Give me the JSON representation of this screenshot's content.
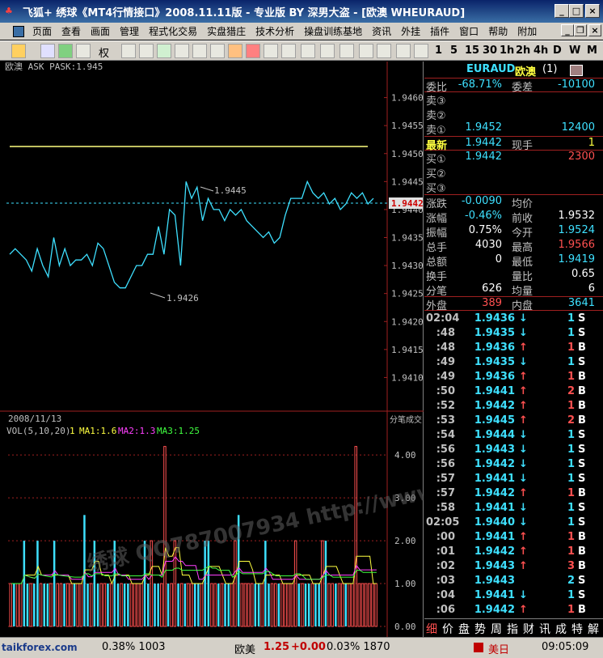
{
  "window": {
    "title": "飞狐+ 绣球《MT4行情接口》2008.11.11版 - 专业版 BY 深男大盗 - [欧澳 WHEURAUD]",
    "btn_minimize": "_",
    "btn_maximize": "□",
    "btn_close": "×",
    "child_minimize": "_",
    "child_restore": "❐",
    "child_close": "×"
  },
  "menu": [
    "页面",
    "查看",
    "画面",
    "管理",
    "程式化交易",
    "实盘猎庄",
    "技术分析",
    "操盘训练基地",
    "资讯",
    "外挂",
    "插件",
    "窗口",
    "帮助",
    "附加"
  ],
  "toolbar": {
    "quan_label": "权",
    "periods": [
      "1",
      "5",
      "15",
      "30",
      "1h",
      "2h",
      "4h",
      "D",
      "W",
      "M"
    ]
  },
  "chart": {
    "header": "欧澳 ASK PASK:1.945",
    "high_label": "1.9445",
    "low_label": "1.9426",
    "current_price_tag": "1.9442",
    "date_label": "2008/11/13",
    "minute_label": "分笔成交",
    "vol_indicator": {
      "name": "VOL(5,10,20)",
      "a": "1",
      "ma1": "MA1:1.6",
      "ma2": "MA2:1.3",
      "ma3": "MA3:1.25"
    },
    "price_ticks": [
      "1.9460",
      "1.9455",
      "1.9450",
      "1.9445",
      "1.9440",
      "1.9435",
      "1.9430",
      "1.9425",
      "1.9420",
      "1.9415",
      "1.9410"
    ],
    "vol_ticks": [
      "4.00",
      "3.00",
      "2.00",
      "1.00",
      "0.00"
    ],
    "watermark": "绣球 QQ787007934  http://www.iks.com",
    "colors": {
      "line": "#3ee0ff",
      "ma1": "#ffff40",
      "ma2": "#ff40ff",
      "ma3": "#40ff40",
      "upbar": "#ff5050",
      "downbar": "#3ee0ff"
    }
  },
  "chart_data": {
    "type": "line",
    "price": [
      1.9432,
      1.9433,
      1.9432,
      1.9431,
      1.9429,
      1.9433,
      1.943,
      1.9428,
      1.9435,
      1.943,
      1.9433,
      1.943,
      1.9431,
      1.9431,
      1.9432,
      1.943,
      1.9434,
      1.9433,
      1.943,
      1.9427,
      1.9426,
      1.9426,
      1.9428,
      1.943,
      1.943,
      1.9432,
      1.9432,
      1.9437,
      1.9432,
      1.944,
      1.9439,
      1.943,
      1.9445,
      1.9442,
      1.9444,
      1.9438,
      1.9442,
      1.944,
      1.944,
      1.9438,
      1.944,
      1.9439,
      1.944,
      1.9438,
      1.9437,
      1.9436,
      1.9435,
      1.9436,
      1.9434,
      1.9435,
      1.9439,
      1.9442,
      1.9442,
      1.9442,
      1.9445,
      1.9443,
      1.9442,
      1.9443,
      1.9441,
      1.9442,
      1.944,
      1.9441,
      1.9443,
      1.9442,
      1.9443,
      1.9441,
      1.9442
    ],
    "ylim": [
      1.9405,
      1.9465
    ],
    "volume_ylim": [
      0,
      4.4
    ]
  },
  "panel": {
    "symbol": "EURAUD",
    "name": "欧澳",
    "num": "(1)",
    "weibi_label": "委比",
    "weibi": "-68.71%",
    "weicha_label": "委差",
    "weicha": "-10100",
    "sell3": "卖③",
    "sell2": "卖②",
    "sell1": "卖①",
    "sell1_price": "1.9452",
    "sell1_vol": "12400",
    "last_label": "最新",
    "last": "1.9442",
    "xianshou_label": "现手",
    "xianshou": "1",
    "buy1": "买①",
    "buy1_price": "1.9442",
    "buy1_vol": "2300",
    "buy2": "买②",
    "buy3": "买③",
    "stats": [
      {
        "l1": "涨跌",
        "v1": "-0.0090",
        "l2": "均价",
        "v2": ""
      },
      {
        "l1": "涨幅",
        "v1": "-0.46%",
        "l2": "前收",
        "v2": "1.9532"
      },
      {
        "l1": "振幅",
        "v1": "0.75%",
        "l2": "今开",
        "v2": "1.9524"
      },
      {
        "l1": "总手",
        "v1": "4030",
        "l2": "最高",
        "v2": "1.9566"
      },
      {
        "l1": "总额",
        "v1": "0",
        "l2": "最低",
        "v2": "1.9419"
      },
      {
        "l1": "换手",
        "v1": "",
        "l2": "量比",
        "v2": "0.65"
      },
      {
        "l1": "分笔",
        "v1": "626",
        "l2": "均量",
        "v2": "6"
      }
    ],
    "waipan_label": "外盘",
    "waipan": "389",
    "neipan_label": "内盘",
    "neipan": "3641",
    "ticks": [
      {
        "t": "02:04",
        "p": "1.9436",
        "d": "down",
        "v": "1",
        "s": "S"
      },
      {
        "t": ":48",
        "p": "1.9435",
        "d": "down",
        "v": "1",
        "s": "S"
      },
      {
        "t": ":48",
        "p": "1.9436",
        "d": "up",
        "v": "1",
        "s": "B"
      },
      {
        "t": ":49",
        "p": "1.9435",
        "d": "down",
        "v": "1",
        "s": "S"
      },
      {
        "t": ":49",
        "p": "1.9436",
        "d": "up",
        "v": "1",
        "s": "B"
      },
      {
        "t": ":50",
        "p": "1.9441",
        "d": "up",
        "v": "2",
        "s": "B"
      },
      {
        "t": ":52",
        "p": "1.9442",
        "d": "up",
        "v": "1",
        "s": "B"
      },
      {
        "t": ":53",
        "p": "1.9445",
        "d": "up",
        "v": "2",
        "s": "B"
      },
      {
        "t": ":54",
        "p": "1.9444",
        "d": "down",
        "v": "1",
        "s": "S"
      },
      {
        "t": ":56",
        "p": "1.9443",
        "d": "down",
        "v": "1",
        "s": "S"
      },
      {
        "t": ":56",
        "p": "1.9442",
        "d": "down",
        "v": "1",
        "s": "S"
      },
      {
        "t": ":57",
        "p": "1.9441",
        "d": "down",
        "v": "1",
        "s": "S"
      },
      {
        "t": ":57",
        "p": "1.9442",
        "d": "up",
        "v": "1",
        "s": "B"
      },
      {
        "t": ":58",
        "p": "1.9441",
        "d": "down",
        "v": "1",
        "s": "S"
      },
      {
        "t": "02:05",
        "p": "1.9440",
        "d": "down",
        "v": "1",
        "s": "S"
      },
      {
        "t": ":00",
        "p": "1.9441",
        "d": "up",
        "v": "1",
        "s": "B"
      },
      {
        "t": ":01",
        "p": "1.9442",
        "d": "up",
        "v": "1",
        "s": "B"
      },
      {
        "t": ":02",
        "p": "1.9443",
        "d": "up",
        "v": "3",
        "s": "B"
      },
      {
        "t": ":03",
        "p": "1.9443",
        "d": "",
        "v": "2",
        "s": "S"
      },
      {
        "t": ":04",
        "p": "1.9441",
        "d": "down",
        "v": "1",
        "s": "S"
      },
      {
        "t": ":06",
        "p": "1.9442",
        "d": "up",
        "v": "1",
        "s": "B"
      }
    ],
    "tabs": [
      "细",
      "价",
      "盘",
      "势",
      "周",
      "指",
      "财",
      "讯",
      "成",
      "特",
      "解"
    ]
  },
  "status": {
    "left_value": "0.38% 1003",
    "name": "欧美",
    "price": "1.25",
    "change": "+0.00",
    "pct_vol": "0.03% 1870",
    "market": "美日",
    "time": "09:05:09",
    "logo": "taikforex.com"
  }
}
